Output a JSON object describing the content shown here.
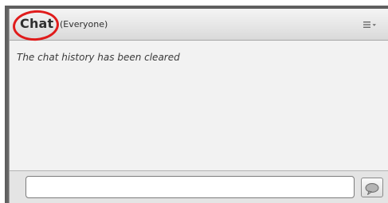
{
  "pod": {
    "title": "Chat",
    "subtitle": "(Everyone)",
    "menu_icon": "options-menu-icon"
  },
  "chat": {
    "messages": [
      {
        "text": "The chat history has been cleared",
        "style": "italic-system"
      }
    ]
  },
  "composer": {
    "input_value": "",
    "input_placeholder": "",
    "send_icon": "speech-bubble-icon"
  },
  "colors": {
    "highlight_ring": "#e01b1b",
    "header_gradient_top": "#f4f4f4",
    "header_gradient_bottom": "#d9d9d9",
    "pod_background": "#f2f2f2",
    "frame_border": "#5f5f5f"
  }
}
